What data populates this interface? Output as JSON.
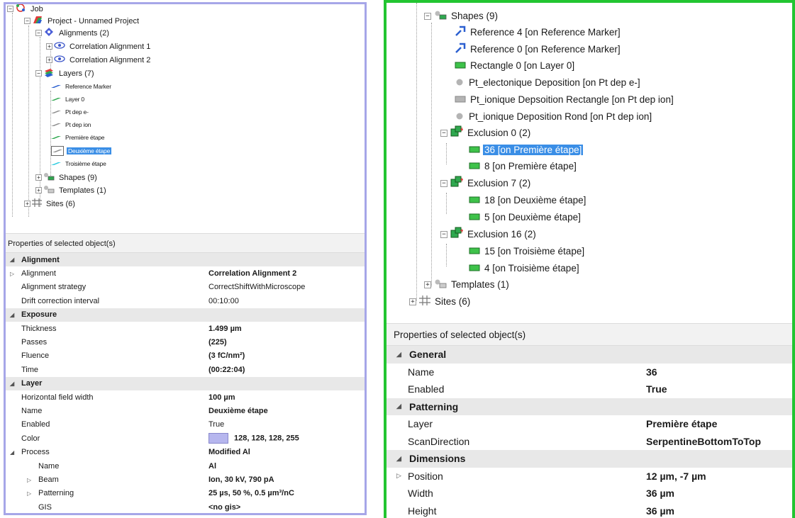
{
  "left": {
    "tree": [
      {
        "label": "Job",
        "icon": "job-icon"
      },
      {
        "label": "Project - Unnamed Project",
        "icon": "project-icon"
      },
      {
        "label": "Alignments (2)",
        "icon": "alignments-icon"
      },
      {
        "label": "Correlation Alignment 1",
        "icon": "eye-icon"
      },
      {
        "label": "Correlation Alignment 2",
        "icon": "eye-icon"
      },
      {
        "label": "Layers (7)",
        "icon": "layers-icon"
      },
      {
        "label": "Reference Marker",
        "icon": "layer-icon"
      },
      {
        "label": "Layer 0",
        "icon": "layer-icon"
      },
      {
        "label": "Pt dep e-",
        "icon": "layer-icon"
      },
      {
        "label": "Pt dep ion",
        "icon": "layer-icon"
      },
      {
        "label": "Première étape",
        "icon": "layer-icon"
      },
      {
        "label": "Deuxième étape",
        "icon": "layer-icon"
      },
      {
        "label": "Troisième étape",
        "icon": "layer-icon"
      },
      {
        "label": "Shapes (9)",
        "icon": "shapes-icon"
      },
      {
        "label": "Templates (1)",
        "icon": "templates-icon"
      },
      {
        "label": "Sites (6)",
        "icon": "sites-icon"
      }
    ],
    "properties_title": "Properties of selected object(s)",
    "properties": [
      {
        "type": "cat",
        "name": "Alignment"
      },
      {
        "name": "Alignment",
        "value": "Correlation Alignment 2"
      },
      {
        "name": "Alignment strategy",
        "value": "CorrectShiftWithMicroscope"
      },
      {
        "name": "Drift correction interval",
        "value": "00:10:00"
      },
      {
        "type": "cat",
        "name": "Exposure"
      },
      {
        "name": "Thickness",
        "value": "1.499 µm"
      },
      {
        "name": "Passes",
        "value": "(225)"
      },
      {
        "name": "Fluence",
        "value": "(3 fC/nm²)"
      },
      {
        "name": "Time",
        "value": "(00:22:04)"
      },
      {
        "type": "cat",
        "name": "Layer"
      },
      {
        "name": "Horizontal field width",
        "value": "100 µm"
      },
      {
        "name": "Name",
        "value": "Deuxième étape"
      },
      {
        "name": "Enabled",
        "value": "True"
      },
      {
        "name": "Color",
        "value": "128, 128, 128, 255"
      },
      {
        "name": "Process",
        "value": "Modified Al"
      },
      {
        "name": "Name",
        "value": "Al"
      },
      {
        "name": "Beam",
        "value": "Ion, 30 kV, 790 pA"
      },
      {
        "name": "Patterning",
        "value": "25 µs, 50 %, 0.5 µm³/nC"
      },
      {
        "name": "GIS",
        "value": "<no gis>"
      }
    ]
  },
  "right": {
    "tree": [
      {
        "label": "Shapes (9)",
        "icon": "shapes-icon"
      },
      {
        "label": "Reference 4 [on Reference Marker]",
        "icon": "reference-marker-icon"
      },
      {
        "label": "Reference 0 [on Reference Marker]",
        "icon": "reference-marker-icon"
      },
      {
        "label": "Rectangle 0 [on Layer 0]",
        "icon": "rectangle-icon"
      },
      {
        "label": "Pt_electonique Deposition [on Pt dep e-]",
        "icon": "circle-icon"
      },
      {
        "label": "Pt_ionique Depsoition Rectangle [on Pt dep ion]",
        "icon": "rectangle-icon"
      },
      {
        "label": "Pt_ionique Deposition Rond [on Pt dep ion]",
        "icon": "circle-icon"
      },
      {
        "label": "Exclusion 0 (2)",
        "icon": "exclusion-icon"
      },
      {
        "label": "36 [on Première étape]",
        "icon": "rectangle-icon"
      },
      {
        "label": "8 [on Première étape]",
        "icon": "rectangle-icon"
      },
      {
        "label": "Exclusion 7 (2)",
        "icon": "exclusion-icon"
      },
      {
        "label": "18 [on Deuxième étape]",
        "icon": "rectangle-icon"
      },
      {
        "label": "5 [on Deuxième étape]",
        "icon": "rectangle-icon"
      },
      {
        "label": "Exclusion 16 (2)",
        "icon": "exclusion-icon"
      },
      {
        "label": "15 [on Troisième étape]",
        "icon": "rectangle-icon"
      },
      {
        "label": "4 [on Troisième étape]",
        "icon": "rectangle-icon"
      },
      {
        "label": "Templates (1)",
        "icon": "templates-icon"
      },
      {
        "label": "Sites (6)",
        "icon": "sites-icon"
      }
    ],
    "properties_title": "Properties of selected object(s)",
    "properties": [
      {
        "type": "cat",
        "name": "General"
      },
      {
        "name": "Name",
        "value": "36"
      },
      {
        "name": "Enabled",
        "value": "True"
      },
      {
        "type": "cat",
        "name": "Patterning"
      },
      {
        "name": "Layer",
        "value": "Première étape"
      },
      {
        "name": "ScanDirection",
        "value": "SerpentineBottomToTop"
      },
      {
        "type": "cat",
        "name": "Dimensions"
      },
      {
        "name": "Position",
        "value": "12 µm, -7 µm"
      },
      {
        "name": "Width",
        "value": "36 µm"
      },
      {
        "name": "Height",
        "value": "36 µm"
      }
    ]
  },
  "colors": {
    "left_border": "#a6a6e8",
    "right_border": "#22c531",
    "selection": "#3a8ee6",
    "layer_swatch": "#b6b6ee"
  }
}
